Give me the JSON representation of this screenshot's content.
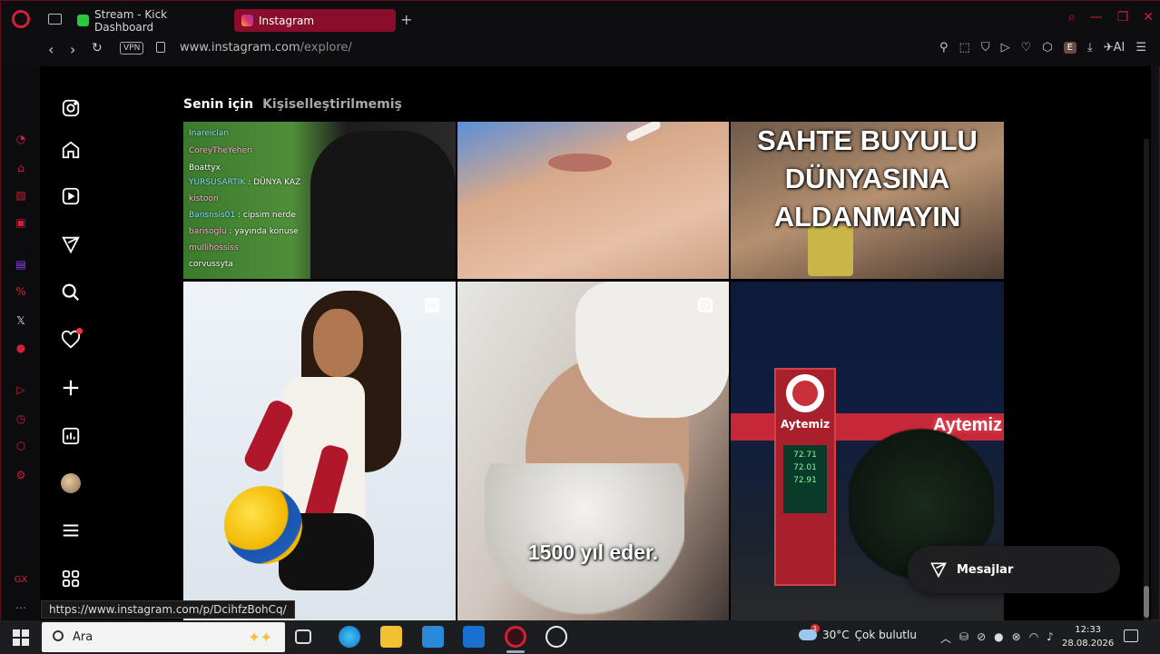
{
  "browser": {
    "tabs": [
      {
        "label": "Stream - Kick Dashboard",
        "icon": "kick-icon",
        "active": false
      },
      {
        "label": "Instagram",
        "icon": "instagram-icon",
        "active": true
      }
    ],
    "vpn_label": "VPN",
    "url_host": "www.instagram.com",
    "url_path": "/explore/",
    "ai_label": "AI",
    "ext_e_label": "E",
    "status_url": "https://www.instagram.com/p/DcihfzBohCq/"
  },
  "instagram": {
    "explore_tabs": [
      {
        "label": "Senin için",
        "active": true
      },
      {
        "label": "Kişiselleştirilmemiş",
        "active": false
      }
    ],
    "nav_items": [
      "instagram-logo-icon",
      "home-icon",
      "reels-icon",
      "explore-icon",
      "search-icon",
      "notifications-icon",
      "create-icon",
      "dashboard-icon",
      "profile-avatar",
      "more-menu-icon",
      "threads-icon"
    ],
    "posts": [
      {
        "type": "stream-chat",
        "chat": [
          {
            "user": "Inareiclan",
            "text": ""
          },
          {
            "user": "CoreyTheYeheri",
            "text": ""
          },
          {
            "user": "Boattyx",
            "text": ""
          },
          {
            "user": "YURSUSARTIK",
            "text": ": DÜNYA KAZ"
          },
          {
            "user": "kistoon",
            "text": ""
          },
          {
            "user": "Bansnsis01",
            "text": ": cipsim nerde"
          },
          {
            "user": "barisoglu",
            "text": ": yayında konuse"
          },
          {
            "user": "mullihossiss",
            "text": ""
          },
          {
            "user": "corvussyta",
            "text": ""
          }
        ]
      },
      {
        "type": "photo-face"
      },
      {
        "type": "text-overlay",
        "lines": [
          "SAHTE BUYULU",
          "DÜNYASINA",
          "ALDANMAYIN"
        ]
      },
      {
        "type": "photo-volleyball"
      },
      {
        "type": "reel-elder",
        "caption": "1500 yıl eder."
      },
      {
        "type": "photo-station",
        "sign": "Aytemiz",
        "canopy": "Aytemiz",
        "prices": [
          "72.71",
          "72.01",
          "72.91"
        ]
      }
    ],
    "messages_label": "Mesajlar"
  },
  "taskbar": {
    "search_placeholder": "Ara",
    "weather_temp": "30°C",
    "weather_desc": "Çok bulutlu",
    "weather_badge": "1",
    "time": "12:33",
    "date": "28.08.2026"
  },
  "colors": {
    "opera_red": "#d0203a",
    "active_tab_bg": "#8a0d2c",
    "notification_dot": "#ff3040"
  }
}
